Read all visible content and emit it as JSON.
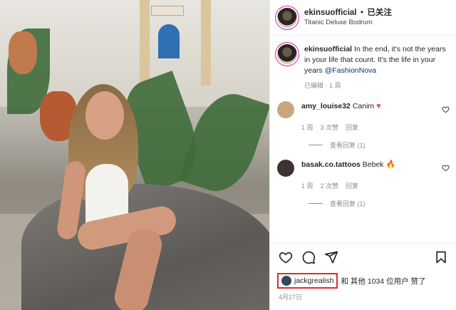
{
  "post": {
    "author": "ekinsuofficial",
    "separator": "•",
    "follow_status": "已关注",
    "location": "Titanic Deluxe Bodrum",
    "photo_alt": "ekinsuofficial post photo"
  },
  "caption": {
    "author": "ekinsuofficial",
    "text": "In the end, it's not the years in your life that count. It's the life in your years",
    "mention": "@FashionNova",
    "meta": "已编辑 · 1 周"
  },
  "comments": [
    {
      "username": "amy_louise32",
      "text": "Canim",
      "emoji": "♥",
      "meta_time": "1 周",
      "meta_likes": "3 次赞",
      "meta_reply": "回复",
      "view_replies": "查看回复 (1)",
      "avatar_color": "#c9a582"
    },
    {
      "username": "basak.co.tattoos",
      "text": "Bebek",
      "emoji": "🔥",
      "meta_time": "1 周",
      "meta_likes": "2 次赞",
      "meta_reply": "回复",
      "view_replies": "查看回复 (1)",
      "avatar_color": "#3b3330"
    }
  ],
  "likes": {
    "liker": "jackgrealish",
    "rest": "和 其他 1034 位用户 赞了"
  },
  "date": "4月27日",
  "icons": {
    "like": "heart-outline-icon",
    "comment": "comment-bubble-icon",
    "share": "paper-plane-icon",
    "save": "bookmark-icon"
  },
  "colors": {
    "mention": "#00376b",
    "highlight_box": "#e12b2b",
    "heart": "#ed4956"
  }
}
